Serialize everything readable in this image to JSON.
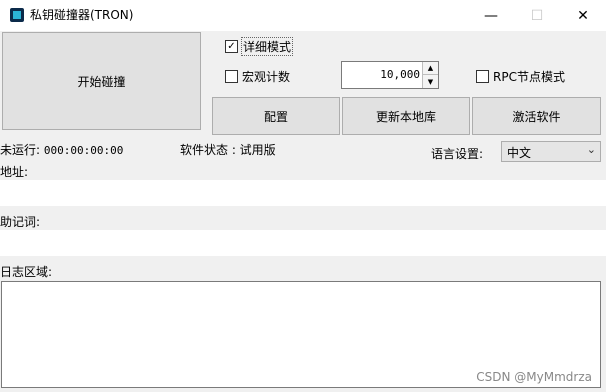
{
  "window": {
    "title": "私钥碰撞器(TRON)",
    "minimize": "—",
    "maximize": "☐",
    "close": "✕"
  },
  "buttons": {
    "start": "开始碰撞",
    "config": "配置",
    "update_db": "更新本地库",
    "activate": "激活软件"
  },
  "options": {
    "detail_mode": {
      "label": "详细模式",
      "checked": true
    },
    "macro_count": {
      "label": "宏观计数",
      "checked": false
    },
    "rpc_mode": {
      "label": "RPC节点模式",
      "checked": false
    },
    "count_value": "10,000"
  },
  "status": {
    "run_label": "未运行:",
    "run_time": "000:00:00:00",
    "software_state": "软件状态 : 试用版"
  },
  "language": {
    "label": "语言设置:",
    "selected": "中文"
  },
  "fields": {
    "address_label": "地址:",
    "mnemonic_label": "助记词:",
    "log_label": "日志区域:"
  },
  "watermark": "CSDN @MyMmdrza"
}
